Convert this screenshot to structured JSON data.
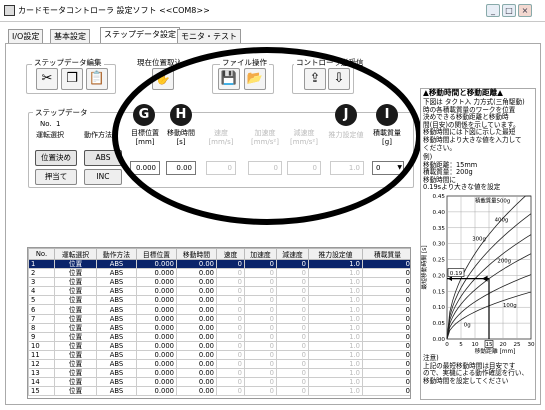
{
  "window": {
    "title": "カードモータコントローラ 設定ソフト <<COM8>>",
    "min_label": "_",
    "max_label": "□",
    "close_label": "×"
  },
  "tabs": [
    "I/O設定",
    "基本設定",
    "ステップデータ設定",
    "モニタ・テスト"
  ],
  "toolbar": {
    "edit_group": "ステップデータ編集",
    "capture_group": "現在位置取込",
    "file_group": "ファイル操作",
    "send_group": "コントローラ送受信"
  },
  "step_panel": {
    "group_label": "ステップデータ",
    "no_label": "No.",
    "no_value": "1",
    "headers": {
      "select": "運転選択",
      "method": "動作方法",
      "target": "目標位置",
      "target_unit": "[mm]",
      "time": "移動時間",
      "time_unit": "[s]",
      "speed": "速度",
      "speed_unit": "[mm/s]",
      "accel": "加速度",
      "accel_unit": "[mm/s²]",
      "decel": "減速度",
      "decel_unit": "[mm/s²]",
      "push": "推力設定値",
      "load": "積載質量",
      "load_unit": "[g]"
    },
    "select_btn": "位置決め",
    "push_btn": "押当て",
    "abs_btn": "ABS",
    "inc_btn": "INC",
    "values": {
      "target": "0.000",
      "time": "0.00",
      "speed": "0",
      "accel": "0",
      "decel": "0",
      "push": "1.0",
      "load": "0"
    }
  },
  "markers": {
    "g": "G",
    "h": "H",
    "j": "J",
    "i": "I"
  },
  "table": {
    "headers": [
      "No.",
      "運転選択",
      "動作方法",
      "目標位置",
      "移動時間",
      "速度",
      "加速度",
      "減速度",
      "推力設定値",
      "積載質量"
    ],
    "rows": [
      [
        "1",
        "位置",
        "ABS",
        "0.000",
        "0.00",
        "0",
        "0",
        "0",
        "1.0",
        "0"
      ],
      [
        "2",
        "位置",
        "ABS",
        "0.000",
        "0.00",
        "0",
        "0",
        "0",
        "1.0",
        "0"
      ],
      [
        "3",
        "位置",
        "ABS",
        "0.000",
        "0.00",
        "0",
        "0",
        "0",
        "1.0",
        "0"
      ],
      [
        "4",
        "位置",
        "ABS",
        "0.000",
        "0.00",
        "0",
        "0",
        "0",
        "1.0",
        "0"
      ],
      [
        "5",
        "位置",
        "ABS",
        "0.000",
        "0.00",
        "0",
        "0",
        "0",
        "1.0",
        "0"
      ],
      [
        "6",
        "位置",
        "ABS",
        "0.000",
        "0.00",
        "0",
        "0",
        "0",
        "1.0",
        "0"
      ],
      [
        "7",
        "位置",
        "ABS",
        "0.000",
        "0.00",
        "0",
        "0",
        "0",
        "1.0",
        "0"
      ],
      [
        "8",
        "位置",
        "ABS",
        "0.000",
        "0.00",
        "0",
        "0",
        "0",
        "1.0",
        "0"
      ],
      [
        "9",
        "位置",
        "ABS",
        "0.000",
        "0.00",
        "0",
        "0",
        "0",
        "1.0",
        "0"
      ],
      [
        "10",
        "位置",
        "ABS",
        "0.000",
        "0.00",
        "0",
        "0",
        "0",
        "1.0",
        "0"
      ],
      [
        "11",
        "位置",
        "ABS",
        "0.000",
        "0.00",
        "0",
        "0",
        "0",
        "1.0",
        "0"
      ],
      [
        "12",
        "位置",
        "ABS",
        "0.000",
        "0.00",
        "0",
        "0",
        "0",
        "1.0",
        "0"
      ],
      [
        "13",
        "位置",
        "ABS",
        "0.000",
        "0.00",
        "0",
        "0",
        "0",
        "1.0",
        "0"
      ],
      [
        "14",
        "位置",
        "ABS",
        "0.000",
        "0.00",
        "0",
        "0",
        "0",
        "1.0",
        "0"
      ],
      [
        "15",
        "位置",
        "ABS",
        "0.000",
        "0.00",
        "0",
        "0",
        "0",
        "1.0",
        "0"
      ]
    ]
  },
  "side": {
    "title": "▲移動時間と移動距離▲",
    "desc": [
      "下図は タクト入 力方式(三角駆動)",
      "時の各積載質量のワークを位置",
      "決めできる移動距離と移動時",
      "間(目安)の関係を示しています。",
      "移動時間には下図に示した最短",
      "移動時間より大きな値を入力して",
      "ください。"
    ],
    "example": [
      "例)",
      "移動距離：15mm",
      "積載質量：200g",
      "移動時間に",
      "0.19sより大きな値を設定"
    ],
    "note": [
      "注意)",
      "上記の最短移動時間は目安です",
      "ので、実機による動作確認を行い、",
      "移動時間を設定してください"
    ],
    "chart": {
      "ylabel": "最短移動時間 [s]",
      "xlabel": "移動距離 [mm]",
      "yticks": [
        "0.45",
        "0.40",
        "0.35",
        "0.30",
        "0.25",
        "0.20",
        "0.15",
        "0.10",
        "0.05",
        "0.00"
      ],
      "xticks": [
        "0",
        "5",
        "10",
        "15",
        "20",
        "25",
        "30"
      ],
      "curve_labels": [
        "積載質量500g",
        "400g",
        "300g",
        "200g",
        "100g",
        "0g"
      ],
      "marker_value": "0.19",
      "marker_x": "15"
    }
  }
}
